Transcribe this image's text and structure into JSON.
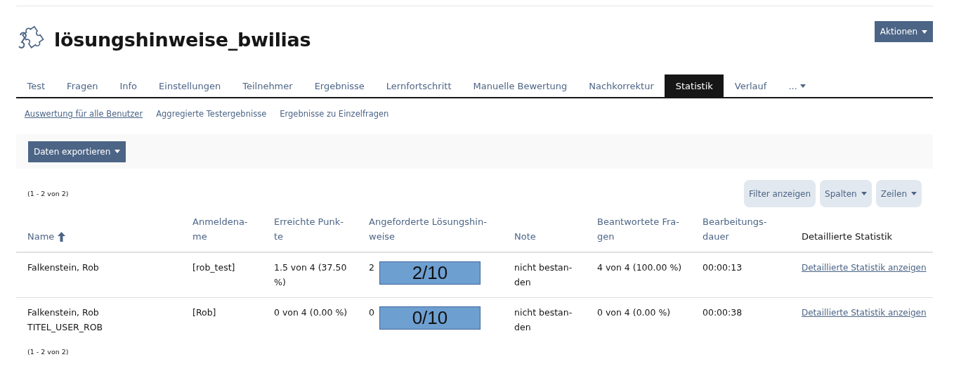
{
  "title": "lösungshinweise_bwilias",
  "actions_button": "Aktionen",
  "tabs": [
    {
      "label": "Test",
      "selected": false
    },
    {
      "label": "Fragen",
      "selected": false
    },
    {
      "label": "Info",
      "selected": false
    },
    {
      "label": "Einstellungen",
      "selected": false
    },
    {
      "label": "Teilnehmer",
      "selected": false
    },
    {
      "label": "Ergebnisse",
      "selected": false
    },
    {
      "label": "Lernfortschritt",
      "selected": false
    },
    {
      "label": "Manuelle Bewertung",
      "selected": false
    },
    {
      "label": "Nachkorrektur",
      "selected": false
    },
    {
      "label": "Statistik",
      "selected": true
    },
    {
      "label": "Verlauf",
      "selected": false
    },
    {
      "label": "...",
      "selected": false,
      "kind": "menu"
    }
  ],
  "subtabs": [
    {
      "label": "Auswertung für alle Benutzer",
      "selected": true
    },
    {
      "label": "Aggregierte Testergebnisse",
      "selected": false
    },
    {
      "label": "Ergebnisse zu Einzelfragen",
      "selected": false
    }
  ],
  "export_button": "Daten exportieren",
  "range_top": "(1 - 2 von 2)",
  "table_buttons": [
    {
      "label": "Filter anzeigen",
      "kind": "plain"
    },
    {
      "label": "Spalten",
      "kind": "menu"
    },
    {
      "label": "Zeilen",
      "kind": "menu"
    }
  ],
  "columns": [
    {
      "label": "Name",
      "sorted": true,
      "sortable": true
    },
    {
      "label": "Anmeldena-\nme",
      "sorted": false,
      "sortable": true
    },
    {
      "label": "Erreichte Punk-\nte",
      "sorted": false,
      "sortable": true
    },
    {
      "label": "Angeforderte Lösungshin-\nweise",
      "sorted": false,
      "sortable": true
    },
    {
      "label": "Note",
      "sorted": false,
      "sortable": true
    },
    {
      "label": "Beantwortete Fra-\ngen",
      "sorted": false,
      "sortable": true
    },
    {
      "label": "Bearbeitungs-\ndauer",
      "sorted": false,
      "sortable": true
    },
    {
      "label": "Detaillierte Statistik",
      "sorted": false,
      "sortable": false
    }
  ],
  "rows": [
    {
      "name": "Falkenstein, Rob",
      "login": "[rob_test]",
      "points": "1.5 von 4 (37.50\n%)",
      "hints": "2",
      "hints_box": "2/10",
      "grade": "nicht bestan-\nden",
      "answered": "4 von 4 (100.00 %)",
      "duration": "00:00:13",
      "detail_link": "Detaillierte Statistik anzeigen"
    },
    {
      "name": "Falkenstein, Rob\nTITEL_USER_ROB",
      "login": "[Rob]",
      "points": "0 von 4 (0.00 %)",
      "hints": "0",
      "hints_box": "0/10",
      "grade": "nicht bestan-\nden",
      "answered": "0 von 4 (0.00 %)",
      "duration": "00:00:38",
      "detail_link": "Detaillierte Statistik anzeigen"
    }
  ],
  "range_bottom": "(1 - 2 von 2)"
}
